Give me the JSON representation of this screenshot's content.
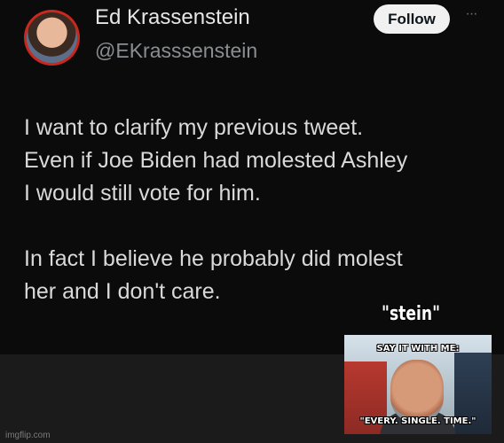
{
  "tweet": {
    "display_name": "Ed Krassenstein",
    "handle": "@EKrasssenstein",
    "follow_label": "Follow",
    "more_label": "···",
    "body_lines": [
      "I want to clarify my previous tweet.",
      "Even if Joe Biden had molested Ashley",
      "I would still vote for him.",
      "In fact I believe he probably did molest",
      "her and I don't care."
    ]
  },
  "overlay": {
    "caption": "\"stein\"",
    "meme_top_text": "SAY IT WITH ME:",
    "meme_bottom_text": "\"EVERY. SINGLE. TIME.\""
  },
  "watermark": "imgflip.com",
  "colors": {
    "background": "#000000",
    "avatar_ring": "#c8281e",
    "follow_button": "#f1f1f1",
    "text_primary": "#d9d9d9",
    "text_secondary": "#8a8d91"
  }
}
